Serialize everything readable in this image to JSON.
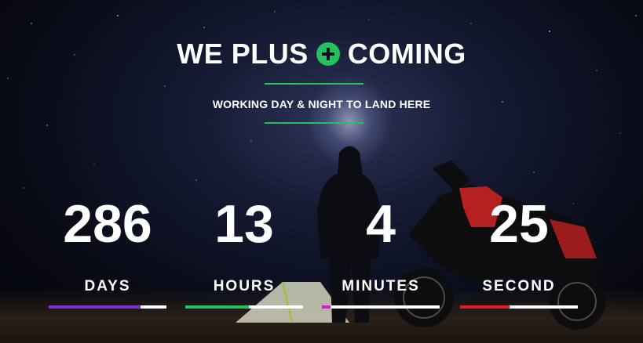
{
  "header": {
    "title_left": "WE PLUS",
    "title_right": "COMING",
    "subtitle": "WORKING DAY & NIGHT TO LAND HERE"
  },
  "countdown": [
    {
      "value": "286",
      "label": "DAYS",
      "progress": 0.78,
      "color": "#7b2fd6"
    },
    {
      "value": "13",
      "label": "HOURS",
      "progress": 0.54,
      "color": "#24c25e"
    },
    {
      "value": "4",
      "label": "MINUTES",
      "progress": 0.07,
      "color": "#d41bd2"
    },
    {
      "value": "25",
      "label": "SECOND",
      "progress": 0.42,
      "color": "#e01f1f"
    }
  ],
  "colors": {
    "accent": "#24c25e"
  }
}
